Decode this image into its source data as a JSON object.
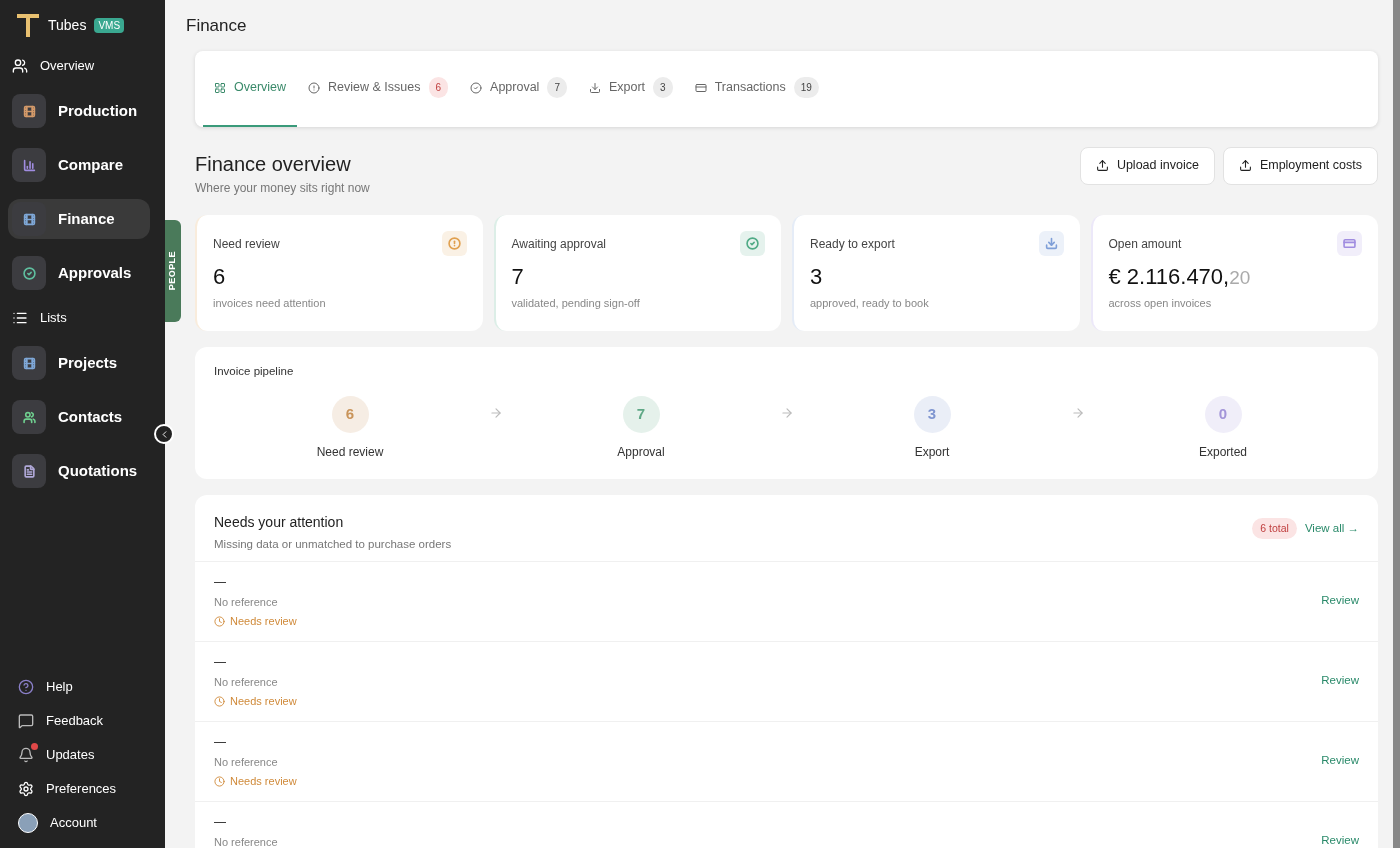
{
  "brand": {
    "name": "Tubes",
    "badge": "VMS"
  },
  "sidebar": {
    "items": [
      {
        "label": "Overview",
        "kind": "plain",
        "selected": false
      },
      {
        "label": "Production",
        "kind": "tile",
        "selected": false,
        "color": "#d49a6a"
      },
      {
        "label": "Compare",
        "kind": "tile",
        "selected": false,
        "color": "#a08ce0"
      },
      {
        "label": "Finance",
        "kind": "tile",
        "selected": true,
        "color": "#7fa8d8"
      },
      {
        "label": "Approvals",
        "kind": "tile",
        "selected": false,
        "color": "#5fbf9f"
      },
      {
        "label": "Lists",
        "kind": "plain",
        "selected": false
      },
      {
        "label": "Projects",
        "kind": "tile",
        "selected": false,
        "color": "#7fa8d8"
      },
      {
        "label": "Contacts",
        "kind": "tile",
        "selected": false,
        "color": "#6fcf8f"
      },
      {
        "label": "Quotations",
        "kind": "tile",
        "selected": false,
        "color": "#b0a8d8"
      }
    ],
    "footer": [
      {
        "label": "Help",
        "unread": false
      },
      {
        "label": "Feedback",
        "unread": false
      },
      {
        "label": "Updates",
        "unread": true
      },
      {
        "label": "Preferences",
        "unread": false
      },
      {
        "label": "Account",
        "unread": false
      }
    ]
  },
  "side_tab": {
    "label": "PEOPLE"
  },
  "page_title": "Finance",
  "tabs": [
    {
      "label": "Overview",
      "selected": true
    },
    {
      "label": "Review & Issues",
      "count": "6",
      "alert": true,
      "selected": false
    },
    {
      "label": "Approval",
      "count": "7",
      "alert": false,
      "selected": false
    },
    {
      "label": "Export",
      "count": "3",
      "alert": false,
      "selected": false
    },
    {
      "label": "Transactions",
      "count": "19",
      "alert": false,
      "selected": false
    }
  ],
  "overview": {
    "title": "Finance overview",
    "subtitle": "Where your money sits right now",
    "buttons": [
      "Upload invoice",
      "Employment costs"
    ]
  },
  "stats": [
    {
      "label": "Need review",
      "value": "6",
      "caption": "invoices need attention",
      "color": "#e0a050"
    },
    {
      "label": "Awaiting approval",
      "value": "7",
      "caption": "validated, pending sign-off",
      "color": "#4faa85"
    },
    {
      "label": "Ready to export",
      "value": "3",
      "caption": "approved, ready to book",
      "color": "#7f9fd8"
    },
    {
      "label": "Open amount",
      "value": "€ 2.116.470,",
      "decimals": "20",
      "caption": "across open invoices",
      "color": "#a08ce0"
    }
  ],
  "pipeline": {
    "title": "Invoice pipeline",
    "stages": [
      {
        "count": "6",
        "label": "Need review",
        "color": "#c9945a"
      },
      {
        "count": "7",
        "label": "Approval",
        "color": "#5fa886"
      },
      {
        "count": "3",
        "label": "Export",
        "color": "#7f95d0"
      },
      {
        "count": "0",
        "label": "Exported",
        "color": "#a395d8"
      }
    ]
  },
  "attention": {
    "title": "Needs your attention",
    "subtitle": "Missing data or unmatched to purchase orders",
    "total": "6 total",
    "link": "View all →",
    "rows": [
      {
        "name": "—",
        "reference": "No reference",
        "status": "Needs review",
        "action": "Review"
      },
      {
        "name": "—",
        "reference": "No reference",
        "status": "Needs review",
        "action": "Review"
      },
      {
        "name": "—",
        "reference": "No reference",
        "status": "Needs review",
        "action": "Review"
      },
      {
        "name": "—",
        "reference": "No reference",
        "action": "Review"
      }
    ]
  }
}
